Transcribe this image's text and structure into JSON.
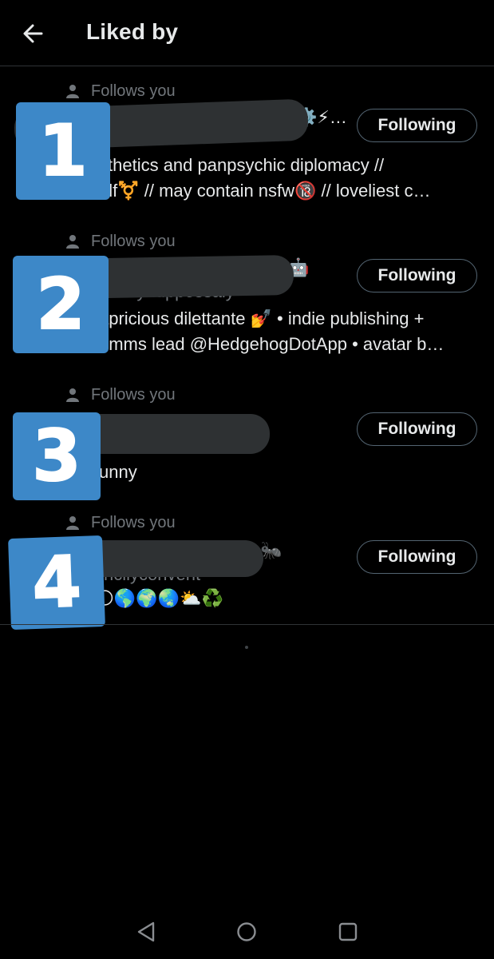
{
  "header": {
    "title": "Liked by",
    "back_icon": "arrow-left-icon"
  },
  "users": [
    {
      "follows_label": "Follows you",
      "name_visible": "⚙️⚡…",
      "handle_visible": "",
      "bio_line1": "sthetics and panpsychic diplomacy //",
      "bio_line2": "elf⚧️ // may contain nsfw🔞 // loveliest c…",
      "follow_label": "Following",
      "badge": "1"
    },
    {
      "follows_label": "Follows you",
      "name_visible": "🤖",
      "handle_visible": "entlyuuppossaly",
      "bio_line1": "apricious dilettante 💅 • indie publishing +",
      "bio_line2": "omms lead @HedgehogDotApp • avatar b…",
      "follow_label": "Following",
      "badge": "2"
    },
    {
      "follows_label": "Follows you",
      "name_visible": "",
      "handle_visible": "",
      "bio_line1": "unny",
      "bio_line2": "",
      "follow_label": "Following",
      "badge": "3"
    },
    {
      "follows_label": "Follows you",
      "name_visible": "🐜",
      "handle_visible": "ncllyconvent",
      "bio_line1": "🌕🌎🌍🌏⛅♻️",
      "bio_line2": "",
      "follow_label": "Following",
      "badge": "4"
    }
  ],
  "nav": {
    "back": "triangle-back-icon",
    "home": "circle-home-icon",
    "recents": "square-recents-icon"
  },
  "colors": {
    "background": "#000000",
    "text_primary": "#e7e9ea",
    "text_secondary": "#71767b",
    "badge_blue": "#3d88c8",
    "redaction": "#2e3133"
  }
}
